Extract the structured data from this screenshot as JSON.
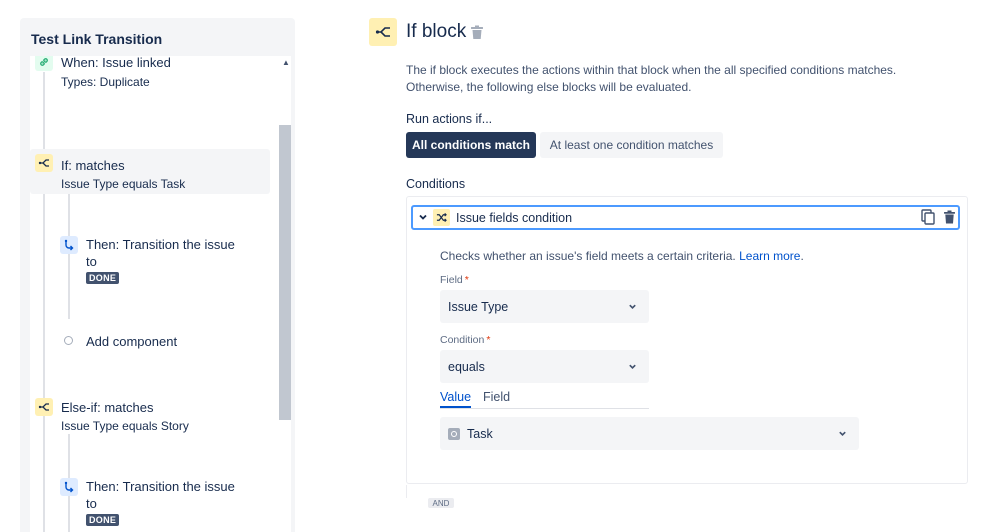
{
  "left_panel": {
    "title": "Test Link Transition",
    "nodes": [
      {
        "title": "When: Issue linked",
        "subtitle": "Types: Duplicate",
        "icon": "link-icon"
      },
      {
        "title": "If: matches",
        "subtitle": "Issue Type equals Task",
        "icon": "branch-icon"
      },
      {
        "title": "Then: Transition the issue",
        "title_line2": "to",
        "badge": "DONE",
        "icon": "transition-icon"
      },
      {
        "title": "Add component",
        "icon": "add-dot"
      },
      {
        "title": "Else-if: matches",
        "subtitle": "Issue Type equals Story",
        "icon": "branch-icon"
      },
      {
        "title": "Then: Transition the issue",
        "title_line2": "to",
        "badge": "DONE",
        "icon": "transition-icon"
      }
    ]
  },
  "editor": {
    "title": "If block",
    "description_line1": "The if block executes the actions within that block when the all specified conditions matches.",
    "description_line2": "Otherwise, the following else blocks will be evaluated.",
    "run_label": "Run actions if...",
    "option_all": "All conditions match",
    "option_least": "At least one condition matches",
    "conditions_label": "Conditions",
    "condition": {
      "title": "Issue fields condition",
      "description": "Checks whether an issue's field meets a certain criteria.",
      "learn_more": "Learn more",
      "learn_more_suffix": ".",
      "field_label": "Field",
      "field_value": "Issue Type",
      "condition_label": "Condition",
      "condition_value": "equals",
      "tab_value": "Value",
      "tab_field": "Field",
      "value_selected": "Task",
      "required_mark": "*"
    },
    "and_label": "AND"
  },
  "colors": {
    "primary_dark": "#253858",
    "link": "#0052cc",
    "focus_border": "#4c9aff",
    "yellow_icon_bg": "#fff0b3",
    "required": "#de350b"
  }
}
